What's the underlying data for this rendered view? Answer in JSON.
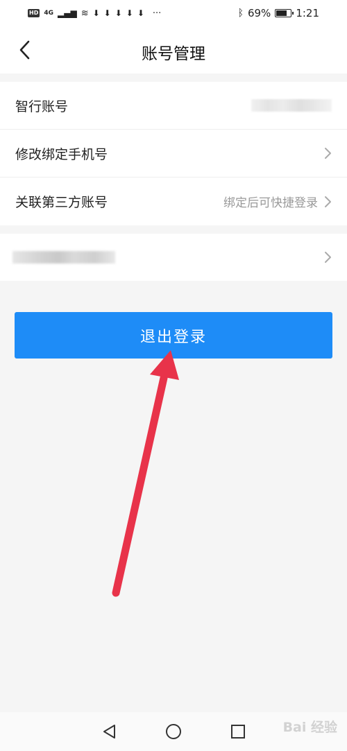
{
  "status_bar": {
    "network_badge": "HD",
    "signal": "4G",
    "download_icons": "⬇⬇⬇⬇⬇",
    "more": "···",
    "battery_percent": "69%",
    "time": "1:21"
  },
  "header": {
    "title": "账号管理"
  },
  "account_rows": [
    {
      "label": "智行账号",
      "value": ""
    },
    {
      "label": "修改绑定手机号",
      "value": ""
    },
    {
      "label": "关联第三方账号",
      "value": "绑定后可快捷登录"
    }
  ],
  "logout_button": {
    "label": "退出登录"
  },
  "watermark": {
    "text": "Bai 经验"
  },
  "colors": {
    "accent": "#1e8cf7",
    "annotation_arrow": "#e8334a",
    "background": "#f5f5f5"
  }
}
